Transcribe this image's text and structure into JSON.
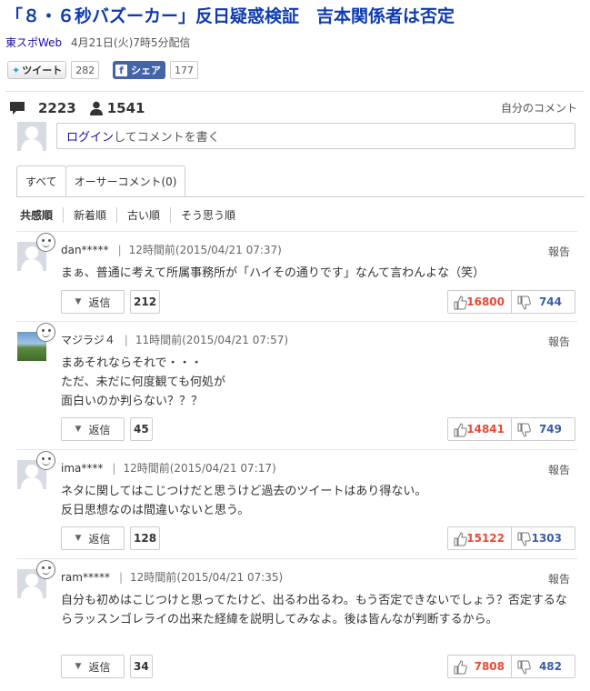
{
  "article": {
    "title": "「８・６秒バズーカー」反日疑惑検証　吉本関係者は否定",
    "source": "東スポWeb",
    "date": "4月21日(火)7時5分配信"
  },
  "share": {
    "tweet_label": "ツイート",
    "tweet_count": "282",
    "fb_label": "シェア",
    "fb_count": "177"
  },
  "stats": {
    "comments": "2223",
    "users": "1541",
    "my_comments_link": "自分のコメント"
  },
  "login": {
    "link": "ログイン",
    "rest": "してコメントを書く"
  },
  "tabs": [
    {
      "label": "すべて"
    },
    {
      "label": "オーサーコメント(0)"
    }
  ],
  "sort": [
    "共感順",
    "新着順",
    "古い順",
    "そう思う順"
  ],
  "comments": [
    {
      "user": "dan*****",
      "time": "12時間前",
      "date": "(2015/04/21 07:37)",
      "text": "まぁ、普通に考えて所属事務所が「ハイその通りです」なんて言わんよな（笑）",
      "reply_label": "返信",
      "replies": "212",
      "likes": "16800",
      "dislikes": "744",
      "report": "報告"
    },
    {
      "user": "マジラジ４",
      "time": "11時間前",
      "date": "(2015/04/21 07:57)",
      "text": "まあそれならそれで・・・\nただ、未だに何度観ても何処が\n面白いのか判らない？？？",
      "reply_label": "返信",
      "replies": "45",
      "likes": "14841",
      "dislikes": "749",
      "report": "報告"
    },
    {
      "user": "ima****",
      "time": "12時間前",
      "date": "(2015/04/21 07:17)",
      "text": "ネタに関してはこじつけだと思うけど過去のツイートはあり得ない。\n反日思想なのは間違いないと思う。",
      "reply_label": "返信",
      "replies": "128",
      "likes": "15122",
      "dislikes": "1303",
      "report": "報告"
    },
    {
      "user": "ram*****",
      "time": "12時間前",
      "date": "(2015/04/21 07:35)",
      "text": "自分も初めはこじつけと思ってたけど、出るわ出るわ。もう否定できないでしょう？否定するならラッスンゴレライの出来た経緯を説明してみなよ。後は皆んなが判断するから。",
      "reply_label": "返信",
      "replies": "34",
      "likes": "7808",
      "dislikes": "482",
      "report": "報告"
    }
  ],
  "colors": {
    "title": "#0e3bb0",
    "link": "#1a0dab",
    "like": "#e64a35",
    "dislike": "#3b5ba8",
    "facebook": "#4464a8"
  }
}
